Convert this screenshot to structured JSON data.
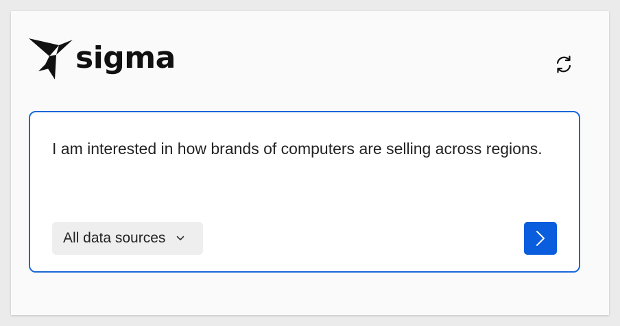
{
  "brand": {
    "name": "sigma",
    "logo_icon": "sigma-bird-logo"
  },
  "header": {
    "refresh_icon": "refresh-icon"
  },
  "prompt": {
    "text": "I am interested in how brands of computers are selling across regions."
  },
  "data_source_select": {
    "selected": "All data sources",
    "icon": "chevron-down-icon"
  },
  "send_button": {
    "icon": "chevron-right-icon"
  },
  "colors": {
    "accent": "#0a5ddc",
    "border": "#1a66d9",
    "card_background": "#fafafa",
    "page_background": "#ebebeb"
  }
}
